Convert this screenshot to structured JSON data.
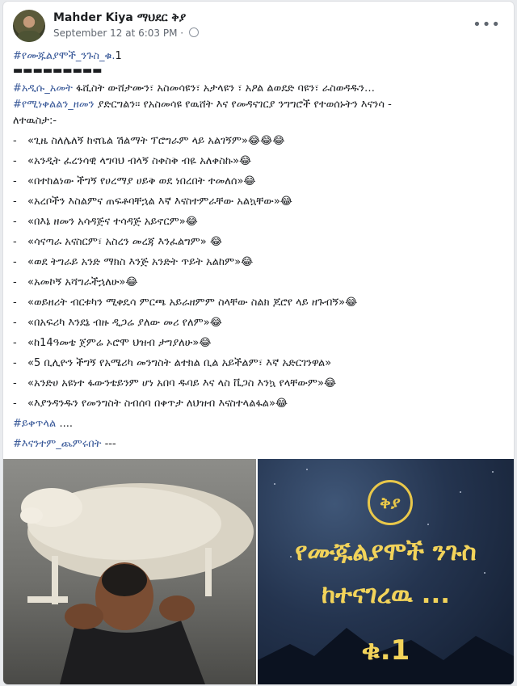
{
  "post": {
    "author": "Mahder Kiya ማህደር ቅያ",
    "timestamp": "September 12 at 6:03 PM",
    "dot": "·",
    "more": "•••",
    "title_hashtag": "#የሙጁልያሞች_ንጉስ_ቁ.",
    "title_number": "1",
    "separator": "▬▬▬▬▬▬▬▬▬",
    "intro_hashtag1": "#አዲሱ_አመት",
    "intro_text1": " ፋሺስት ውሸታሙን፣ አስመሳዩን፣ አታላዩን ፣ አዖል ልወደድ ባዩን፣ ራስወዳዱን…",
    "intro_hashtag2": "#የሚነቀልልን_ዘመን",
    "intro_text2": " ያድርግልን፡፡ የአስመሳዩ የዉሸት እና የመዳናገርያ ንግግሮች የተወሰኑትን እናንሳ -",
    "intro_text3": "ለተዉስታ:-",
    "quotes": [
      {
        "dash": "-",
        "text": "«ጊዜ ስለሌለኝ ከኖቤል ሽልማት ፕሮግራም ላይ አልገኝም»😂😂😂"
      },
      {
        "dash": "-",
        "text": "«አንዲት ፈረንሳዊ ላግባህ ብላኝ ስቀስቅ ብዬ አለቀስኩ»😂"
      },
      {
        "dash": "-",
        "text": "«በተከልነው ችግኝ የሀረማያ ሀይቅ ወደ ነበረበት ተመለሰ»😂"
      },
      {
        "dash": "-",
        "text": "«አረቦችን እስልምና ጠፍቶባቸኋል እኛ እናስተምራቸው አልኳቸው»😂"
      },
      {
        "dash": "-",
        "text": "«በእኔ ዘመን አሳዳጅና ተሳዳጅ አይኖርም»😂"
      },
      {
        "dash": "-",
        "text": "«ሳናጣራ አናስርም፣ አስረን መረጃ እንፈልግም» 😂"
      },
      {
        "dash": "-",
        "text": "«ወደ ትግራይ አንድ ማክስ እንጅ አንድት ጥይት አልከም»😂"
      },
      {
        "dash": "-",
        "text": "«አመኮኝ አሻግራችኋለሁ»😂"
      },
      {
        "dash": "-",
        "text": "«ወይዘሪት ብርቱካን ሚቀዴሳ ምርጫ አይራዘምም ስላቸው ስልክ ጆሮየ ላይ ዘጉብኝ»😂"
      },
      {
        "dash": "-",
        "text": "«በአፍሪካ እንደኔ ብዙ ዲጋሬ ያለው መሪ የለም»😂"
      },
      {
        "dash": "-",
        "text": "«ከ14ዓመቴ ጀምሬ ኦሮሞ ህዝብ ታግያለሁ»😂"
      },
      {
        "dash": "-",
        "text": "«5 ቢሊዮን ችግኝ የአሜሪካ መንግስት ልተክል ቢል አይችልም፣ እኛ አድርገንዋል»"
      },
      {
        "dash": "-",
        "text": "«አንድሀ አዩነተ ፋውንቴይንም ሆነ አበባ ዱባይ እና ላስ ቬጋስ እንኳ የላቸውም»😂"
      },
      {
        "dash": "-",
        "text": "«እያንዳንዱን የመንግስት ስብሰባ በቀጥታ ለህዝብ እናስተላልፋል»😂"
      }
    ],
    "continues_hashtag": "#ይቀጥላል",
    "continues_dots": " ....",
    "final_hashtag": "#እናንተም_ጨምሩበት",
    "final_dashes": " ---"
  },
  "image_right": {
    "logo_text": "ቅያ",
    "title_line1": "የሙጁልያሞች ንጉስ",
    "title_line2": "ከተናገረዉ ...",
    "number": "ቁ.1"
  },
  "colors": {
    "link": "#385898",
    "gold": "#f2d35a",
    "background": "#e9ebee"
  },
  "icons": {
    "privacy": "globe-icon",
    "options": "more-options-icon"
  }
}
